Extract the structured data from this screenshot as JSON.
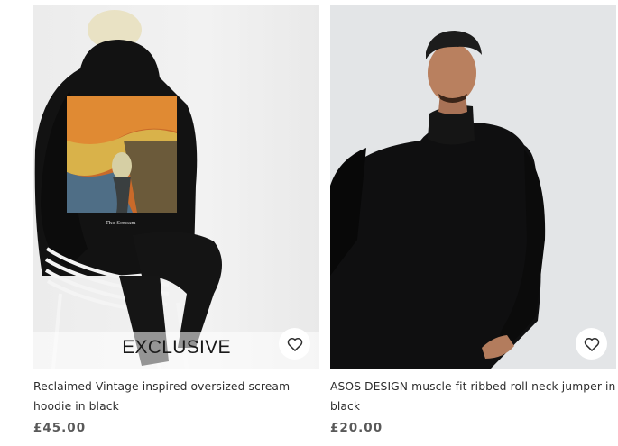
{
  "products": [
    {
      "badge": "EXCLUSIVE",
      "title": "Reclaimed Vintage inspired oversized scream hoodie in black",
      "price": "£45.00",
      "print_caption": "The Scream",
      "save_icon": "heart-outline-icon"
    },
    {
      "title": "ASOS DESIGN muscle fit ribbed roll neck jumper in black",
      "price": "£20.00",
      "save_icon": "heart-outline-icon"
    }
  ]
}
